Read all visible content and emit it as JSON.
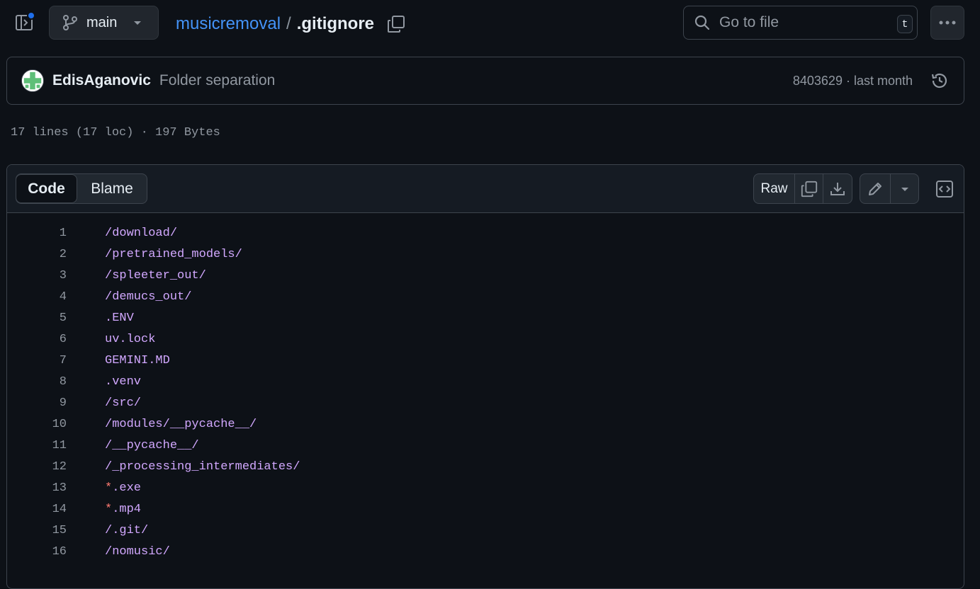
{
  "header": {
    "branch": "main",
    "repo": "musicremoval",
    "separator": "/",
    "file": ".gitignore",
    "search_placeholder": "Go to file",
    "search_shortcut": "t"
  },
  "commit": {
    "author": "EdisAganovic",
    "message": "Folder separation",
    "meta": "8403629 · last month"
  },
  "file_stats": "17 lines (17 loc) · 197 Bytes",
  "toolbar": {
    "code_tab": "Code",
    "blame_tab": "Blame",
    "raw_label": "Raw"
  },
  "lines": [
    {
      "n": "1",
      "prefix": "",
      "text": "/download/"
    },
    {
      "n": "2",
      "prefix": "",
      "text": "/pretrained_models/"
    },
    {
      "n": "3",
      "prefix": "",
      "text": "/spleeter_out/"
    },
    {
      "n": "4",
      "prefix": "",
      "text": "/demucs_out/"
    },
    {
      "n": "5",
      "prefix": "",
      "text": ".ENV"
    },
    {
      "n": "6",
      "prefix": "",
      "text": "uv.lock"
    },
    {
      "n": "7",
      "prefix": "",
      "text": "GEMINI.MD"
    },
    {
      "n": "8",
      "prefix": "",
      "text": ".venv"
    },
    {
      "n": "9",
      "prefix": "",
      "text": "/src/"
    },
    {
      "n": "10",
      "prefix": "",
      "text": "/modules/__pycache__/"
    },
    {
      "n": "11",
      "prefix": "",
      "text": "/__pycache__/"
    },
    {
      "n": "12",
      "prefix": "",
      "text": "/_processing_intermediates/"
    },
    {
      "n": "13",
      "prefix": "*",
      "text": ".exe"
    },
    {
      "n": "14",
      "prefix": "*",
      "text": ".mp4"
    },
    {
      "n": "15",
      "prefix": "",
      "text": "/.git/"
    },
    {
      "n": "16",
      "prefix": "",
      "text": "/nomusic/"
    }
  ],
  "colors": {
    "background": "#0d1117",
    "link": "#4493f8",
    "code_text": "#d2a8ff",
    "wildcard": "#ff7b72",
    "notification": "#1f6feb"
  },
  "icons": [
    "sidebar-toggle-icon",
    "git-branch-icon",
    "chevron-down-icon",
    "copy-icon",
    "search-icon",
    "kebab-menu-icon",
    "history-icon",
    "download-icon",
    "pencil-icon",
    "code-square-icon"
  ]
}
